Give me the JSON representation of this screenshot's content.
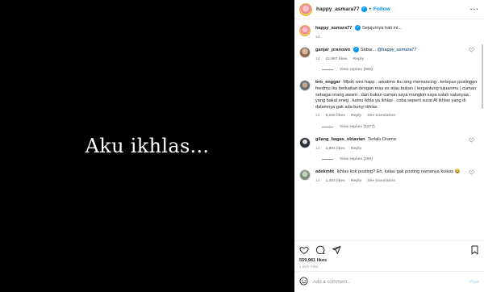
{
  "media": {
    "caption_text": "Aku ikhlas..."
  },
  "header": {
    "username": "happy_asmara77",
    "verified_symbol": "✓",
    "separator": "•",
    "follow_label": "Follow",
    "more_label": "···"
  },
  "caption": {
    "username": "happy_asmara77",
    "verified_symbol": "✓",
    "text": "Sejujurnya hati ini...",
    "time": "1d"
  },
  "comments": [
    {
      "username": "ganjar_pranowo",
      "verified_symbol": "✓",
      "text_prefix": "Sabar... ",
      "mention": "@happy_asmara77",
      "time": "1d",
      "likes": "22,987 likes",
      "reply_label": "Reply",
      "see_translation": "",
      "view_replies": "View replies (995)"
    },
    {
      "username": "bro_enggar",
      "text": "Mbok wes happ . awakmu iku sing memancing . terlepas postingan feedmu iku berkaitan dengan mas ex atau bukan ( tergantung tujuanmu ) cuman sebagai orang awam . dan bukan cuman saya mungkin saya salah satunyaa . yang bakal eneg . kamu ikhla ya ikhlas . coba seperti surat Al ikhlas yang di dalamnya gak ada bunyi ikhlas .",
      "time": "1d",
      "likes": "6,040 likes",
      "reply_label": "Reply",
      "see_translation": "See translation",
      "view_replies": "View replies (1277)"
    },
    {
      "username": "gilang_bagas_oktavian",
      "text": "Terlalu Drama",
      "time": "1d",
      "likes": "2,891 likes",
      "reply_label": "Reply",
      "see_translation": "",
      "view_replies": "View replies (290)"
    },
    {
      "username": "adekmht",
      "text": "Ikhlas kok posting? Eh, kalau gak posting namanya kuikas 😂",
      "time": "1d",
      "likes": "1,403 likes",
      "reply_label": "Reply",
      "see_translation": "See translation",
      "view_replies": ""
    }
  ],
  "icons": {
    "like": "heart-icon",
    "comment": "comment-icon",
    "share": "share-icon",
    "save": "bookmark-icon",
    "emoji": "emoji-icon",
    "comment_like": "small-heart-icon"
  },
  "footer": {
    "likes": "559,961 likes",
    "posted": "1 DAY AGO",
    "add_comment_placeholder": "Add a comment...",
    "post_label": "Post"
  },
  "colors": {
    "accent": "#0095f6",
    "media_bg": "#000000",
    "muted": "#8e8e8e"
  }
}
